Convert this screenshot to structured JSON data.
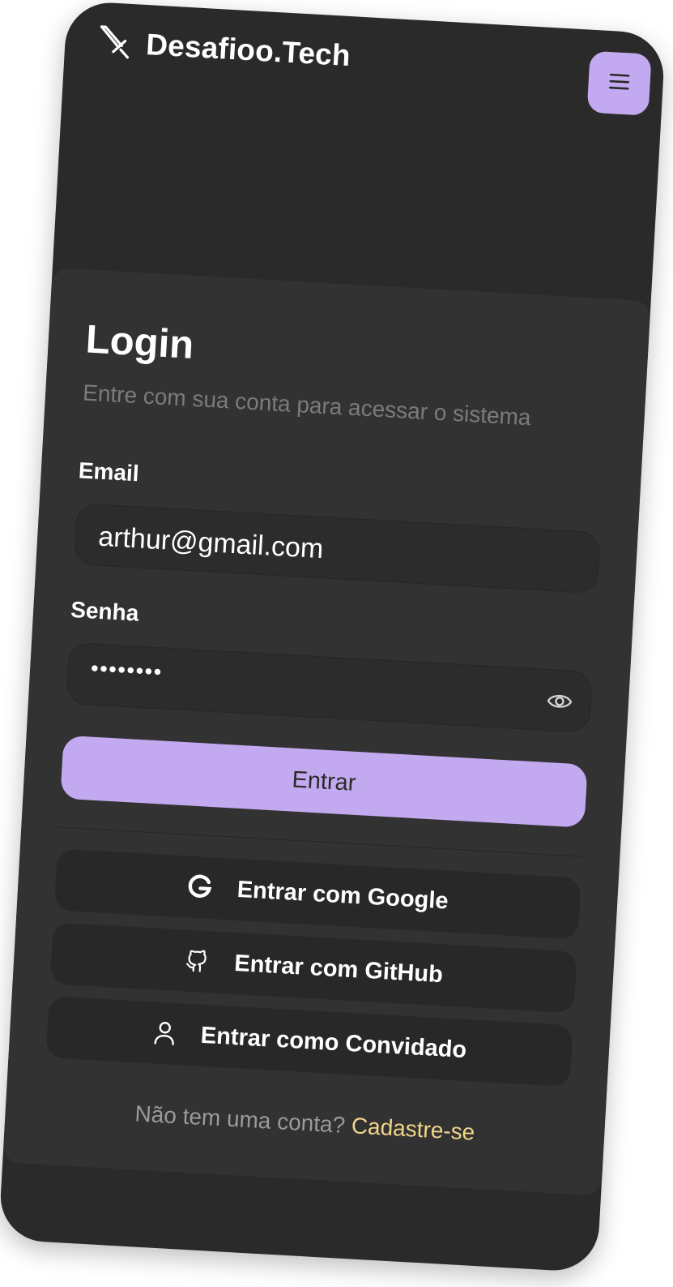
{
  "app": {
    "brand": "Desafioo.Tech"
  },
  "login": {
    "title": "Login",
    "subtitle": "Entre com sua conta para acessar o sistema",
    "email_label": "Email",
    "email_value": "arthur@gmail.com",
    "password_label": "Senha",
    "password_value": "••••••••",
    "submit_label": "Entrar"
  },
  "social": {
    "google_label": "Entrar com Google",
    "github_label": "Entrar com GitHub",
    "guest_label": "Entrar como Convidado"
  },
  "footer": {
    "prompt": "Não tem uma conta?",
    "link": "Cadastre-se"
  },
  "icons": {
    "logo": "sword-icon",
    "menu": "hamburger-menu-icon",
    "password_toggle": "eye-icon",
    "google": "google-icon",
    "github": "github-icon",
    "guest": "user-icon"
  },
  "colors": {
    "background": "#2a2a2a",
    "card": "#323232",
    "accent": "#c3aaf0",
    "link": "#f0d48a",
    "muted_text": "#7b7b7b"
  }
}
